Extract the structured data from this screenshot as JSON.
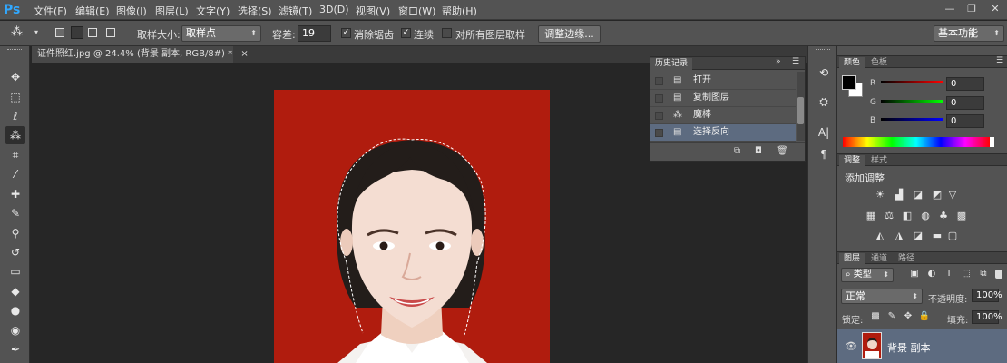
{
  "app": {
    "logo": "Ps"
  },
  "menu": [
    "文件(F)",
    "编辑(E)",
    "图像(I)",
    "图层(L)",
    "文字(Y)",
    "选择(S)",
    "滤镜(T)",
    "3D(D)",
    "视图(V)",
    "窗口(W)",
    "帮助(H)"
  ],
  "window_controls": {
    "minimize": "—",
    "restore": "❐",
    "close": "✕"
  },
  "options": {
    "sample_size_label": "取样大小:",
    "sample_size_value": "取样点",
    "tolerance_label": "容差:",
    "tolerance_value": "19",
    "antialias_label": "消除锯齿",
    "antialias_checked": true,
    "contiguous_label": "连续",
    "contiguous_checked": true,
    "all_layers_label": "对所有图层取样",
    "all_layers_checked": false,
    "refine_edge_button": "调整边缘...",
    "workspace_value": "基本功能"
  },
  "document": {
    "tab_title": "证件照红.jpg @ 24.4% (背景 副本, RGB/8#) *",
    "close_glyph": "×",
    "background_color": "#b01c0e"
  },
  "history": {
    "tab_label": "历史记录",
    "items": [
      {
        "label": "打开",
        "icon": "document-icon"
      },
      {
        "label": "复制图层",
        "icon": "document-icon"
      },
      {
        "label": "魔棒",
        "icon": "magic-wand-icon"
      },
      {
        "label": "选择反向",
        "icon": "document-icon",
        "selected": true
      }
    ]
  },
  "color_panel": {
    "tabs": [
      "颜色",
      "色板"
    ],
    "channels": [
      {
        "label": "R",
        "value": "0",
        "color": "#ff2020"
      },
      {
        "label": "G",
        "value": "0",
        "color": "#20d020"
      },
      {
        "label": "B",
        "value": "0",
        "color": "#2040ff"
      }
    ]
  },
  "adjustments_panel": {
    "tabs": [
      "调整",
      "样式"
    ],
    "add_label": "添加调整"
  },
  "layers_panel": {
    "tabs": [
      "图层",
      "通道",
      "路径"
    ],
    "filter_label": "类型",
    "blend_mode": "正常",
    "opacity_label": "不透明度:",
    "opacity_value": "100%",
    "lock_label": "锁定:",
    "fill_label": "填充:",
    "fill_value": "100%",
    "layers": [
      {
        "name": "背景 副本"
      }
    ]
  }
}
